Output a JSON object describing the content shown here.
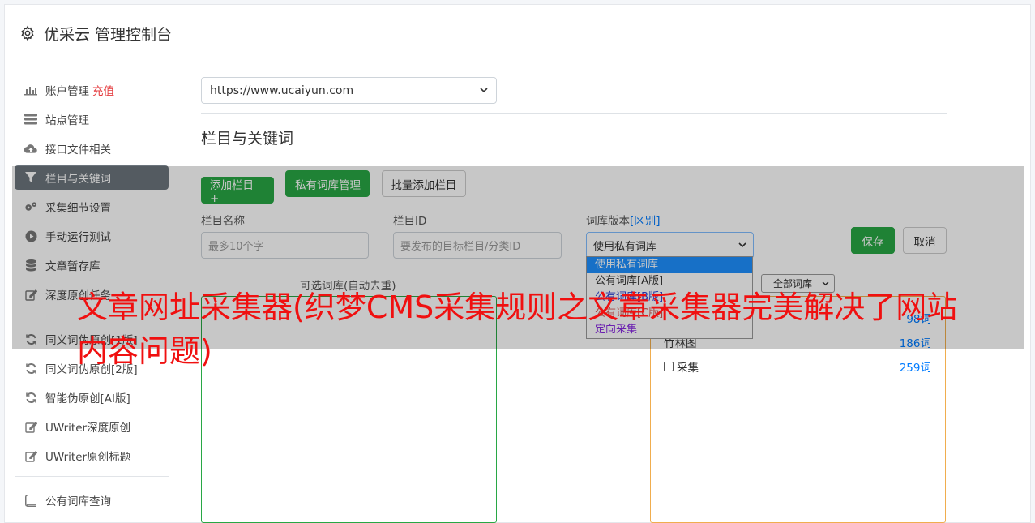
{
  "app": {
    "title": "优采云 管理控制台",
    "icon": "gear-icon"
  },
  "sidebar": {
    "items": [
      {
        "label": "账户管理",
        "badge": "充值",
        "icon": "bar-chart-icon"
      },
      {
        "label": "站点管理",
        "icon": "server-icon"
      },
      {
        "label": "接口文件相关",
        "icon": "cloud-upload-icon"
      },
      {
        "label": "栏目与关键词",
        "icon": "filter-icon",
        "active": true
      },
      {
        "label": "采集细节设置",
        "icon": "cogs-icon"
      },
      {
        "label": "手动运行测试",
        "icon": "play-circle-icon"
      },
      {
        "label": "文章暂存库",
        "icon": "database-icon"
      },
      {
        "label": "深度原创任务",
        "icon": "edit-icon"
      },
      {
        "label": "同义词伪原创[1版]",
        "icon": "refresh-icon"
      },
      {
        "label": "同义词伪原创[2版]",
        "icon": "refresh-icon"
      },
      {
        "label": "智能伪原创[AI版]",
        "icon": "refresh-icon"
      },
      {
        "label": "UWriter深度原创",
        "icon": "edit-icon"
      },
      {
        "label": "UWriter原创标题",
        "icon": "edit-icon"
      },
      {
        "label": "公有词库查询",
        "icon": "book-icon"
      }
    ]
  },
  "main": {
    "site_select": "https://www.ucaiyun.com",
    "section_title": "栏目与关键词",
    "buttons": {
      "add_column": "添加栏目 +",
      "private_lib": "私有词库管理",
      "batch_add": "批量添加栏目"
    },
    "form": {
      "name_label": "栏目名称",
      "name_placeholder": "最多10个字",
      "id_label": "栏目ID",
      "id_placeholder": "要发布的目标栏目/分类ID",
      "version_label": "词库版本",
      "version_link": "[区别]",
      "version_value": "使用私有词库",
      "save": "保存",
      "cancel": "取消"
    },
    "dropdown_options": [
      {
        "label": "使用私有词库",
        "color": "#ffffff",
        "selected": true
      },
      {
        "label": "公有词库[A版]",
        "color": "#333333"
      },
      {
        "label": "公有词库[B版]",
        "color": "#2a3fd6"
      },
      {
        "label": "公有词库[C版]",
        "color": "#d9534f"
      },
      {
        "label": "定向采集",
        "color": "#8a2be2"
      }
    ],
    "left_panel_label": "可选词库(自动去重)",
    "right_panel_filter": "全部词库",
    "libraries": [
      {
        "name": "",
        "count": "98词"
      },
      {
        "name": "竹林图",
        "count": "186词"
      },
      {
        "name": "采集",
        "count": "259词"
      }
    ]
  },
  "headline": "文章网址采集器(织梦CMS采集规则之文章采集器完美解决了网站内容问题)"
}
